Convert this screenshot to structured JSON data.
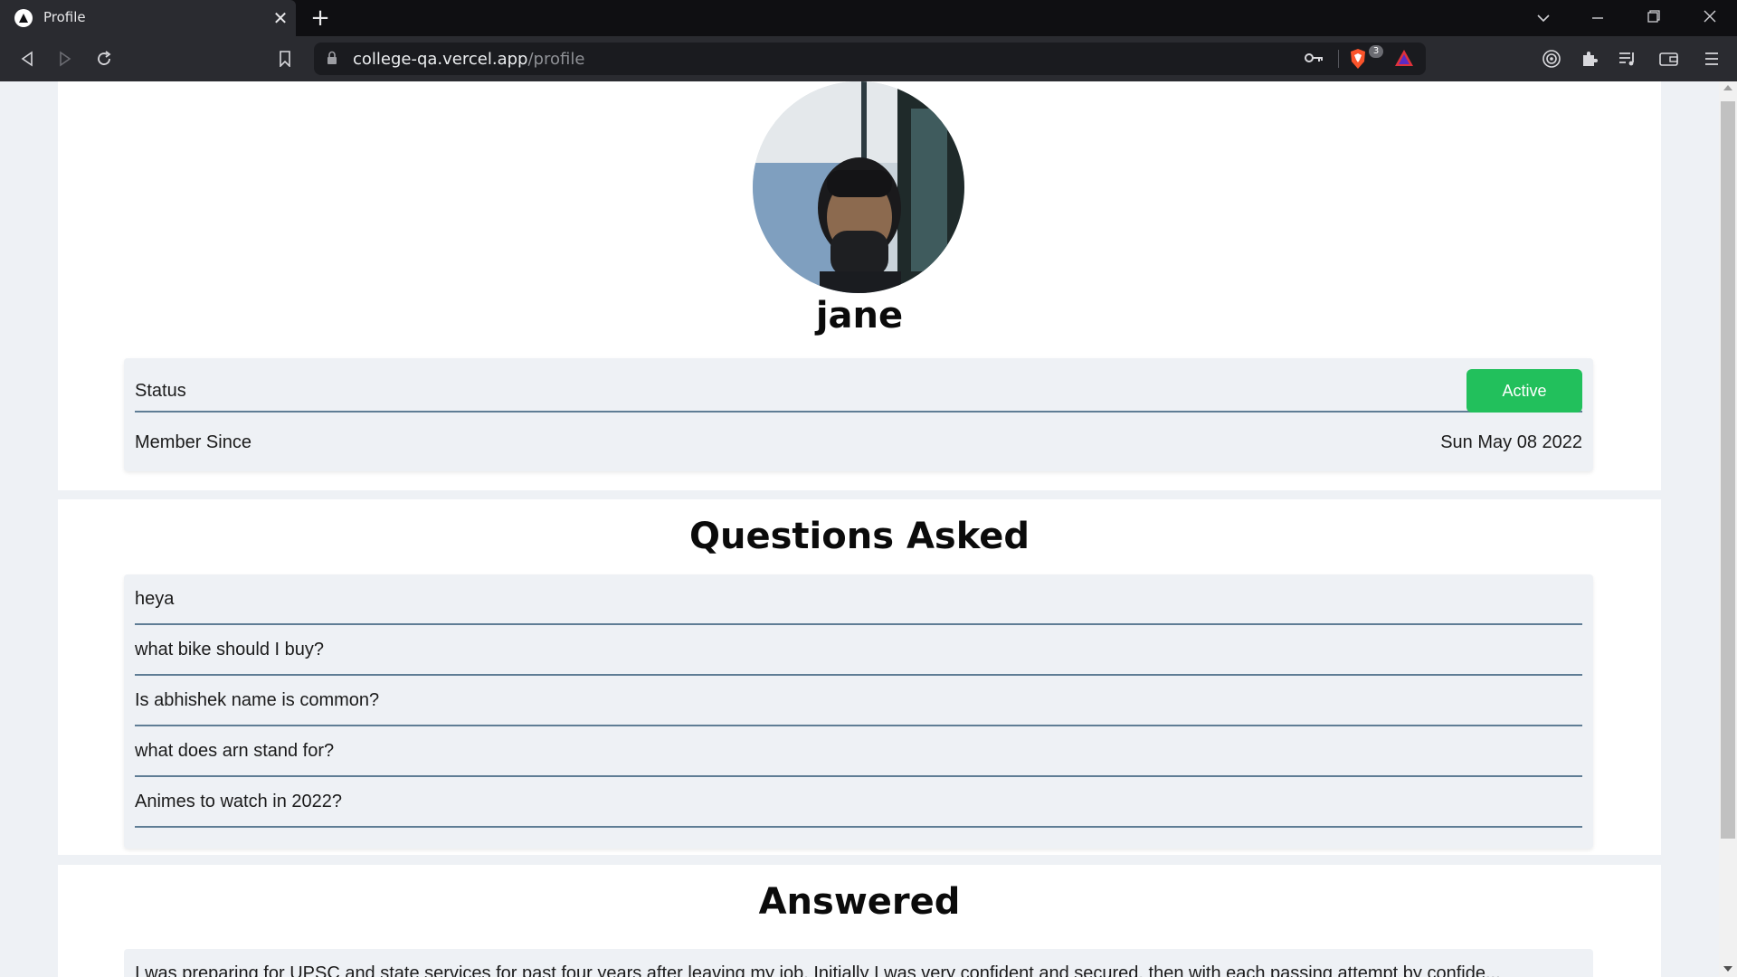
{
  "browser": {
    "tab_title": "Profile",
    "url_host": "college-qa.vercel.app",
    "url_path": "/profile",
    "shield_count": "3",
    "accent": "#fb542b"
  },
  "profile": {
    "username": "jane",
    "avatar": "user-avatar-photo",
    "status_label": "Status",
    "status_value": "Active",
    "status_color": "#22c05c",
    "member_label": "Member Since",
    "member_value": "Sun May 08 2022"
  },
  "questions": {
    "title": "Questions Asked",
    "items": [
      {
        "text": "heya"
      },
      {
        "text": "what bike should I buy?"
      },
      {
        "text": "Is abhishek name is common?"
      },
      {
        "text": "what does arn stand for?"
      },
      {
        "text": "Animes to watch in 2022?"
      }
    ]
  },
  "answered": {
    "title": "Answered",
    "items": [
      {
        "text": "I was preparing for UPSC and state services for past four years after leaving my job. Initially I was very confident and secured, then with each passing attempt by confide..."
      }
    ]
  }
}
